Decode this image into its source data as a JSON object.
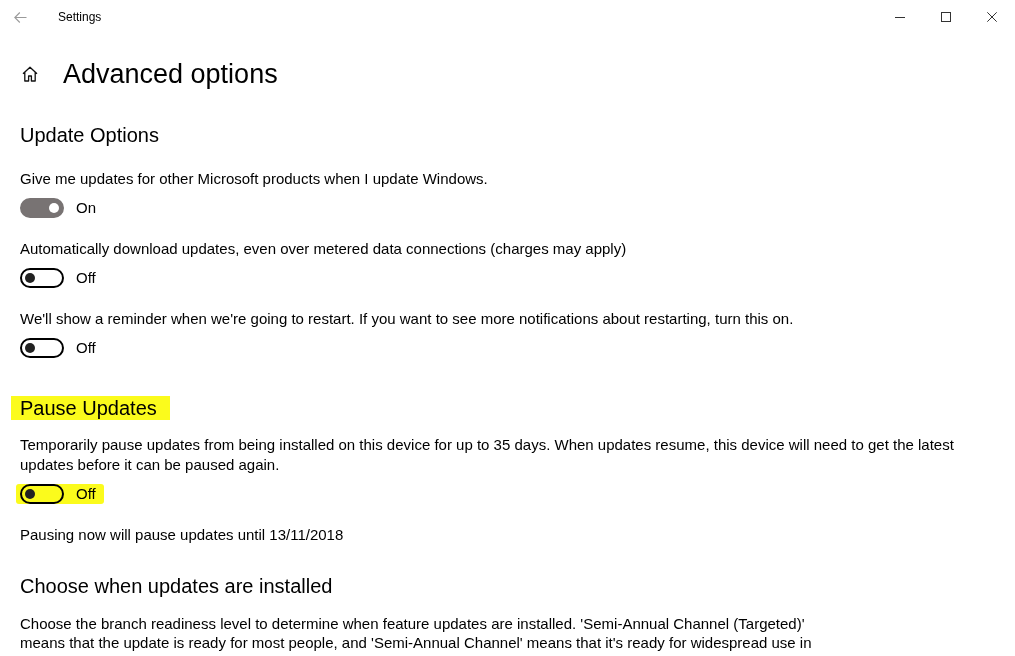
{
  "window": {
    "title": "Settings"
  },
  "page": {
    "title": "Advanced options"
  },
  "sections": [
    {
      "heading": "Update Options",
      "highlighted": false,
      "items": [
        {
          "kind": "toggle",
          "description": "Give me updates for other Microsoft products when I update Windows.",
          "on": true,
          "state_label": "On",
          "highlighted": false
        },
        {
          "kind": "toggle",
          "description": "Automatically download updates, even over metered data connections (charges may apply)",
          "on": false,
          "state_label": "Off",
          "highlighted": false
        },
        {
          "kind": "toggle",
          "description": "We'll show a reminder when we're going to restart. If you want to see more notifications about restarting, turn this on.",
          "on": false,
          "state_label": "Off",
          "highlighted": false
        }
      ]
    },
    {
      "heading": "Pause Updates",
      "highlighted": true,
      "items": [
        {
          "kind": "toggle",
          "description": "Temporarily pause updates from being installed on this device for up to 35 days. When updates resume, this device will need to get the latest updates before it can be paused again.",
          "on": false,
          "state_label": "Off",
          "highlighted": true
        },
        {
          "kind": "note",
          "text": "Pausing now will pause updates until 13/11/2018"
        }
      ]
    },
    {
      "heading": "Choose when updates are installed",
      "highlighted": false,
      "items": [
        {
          "kind": "note",
          "text": "Choose the branch readiness level to determine when feature updates are installed. 'Semi-Annual Channel (Targeted)' means that the update is ready for most people, and 'Semi-Annual Channel' means that it's ready for widespread use in"
        }
      ]
    }
  ]
}
